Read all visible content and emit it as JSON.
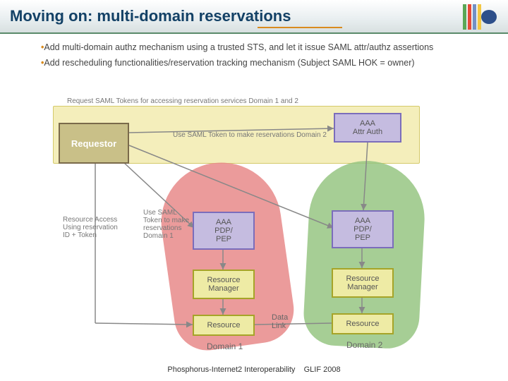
{
  "header": {
    "title": "Moving on: multi-domain reservations"
  },
  "bullets": {
    "b1": "Add multi-domain authz mechanism using a trusted STS, and let it issue SAML attr/authz assertions",
    "b2": "Add rescheduling functionalities/reservation tracking mechanism (Subject SAML HOK = owner)"
  },
  "diagram": {
    "requestor": "Requestor",
    "aaa_auth": "AAA\nAttr Auth",
    "aaa_pdp": "AAA\nPDP/\nPEP",
    "resource_mgr": "Resource\nManager",
    "resource": "Resource",
    "labels": {
      "request_tokens": "Request SAML Tokens for accessing reservation services Domain 1 and 2",
      "use_token_d2": "Use SAML Token to make reservations Domain 2",
      "resource_access": "Resource Access Using reservation ID + Token",
      "use_token_d1": "Use SAML Token to make reservations Domain 1",
      "domain1": "Domain 1",
      "domain2": "Domain 2",
      "data_link": "Data\nLink"
    }
  },
  "footer": {
    "left": "Phosphorus-Internet2 Interoperability",
    "right": "GLIF 2008"
  }
}
